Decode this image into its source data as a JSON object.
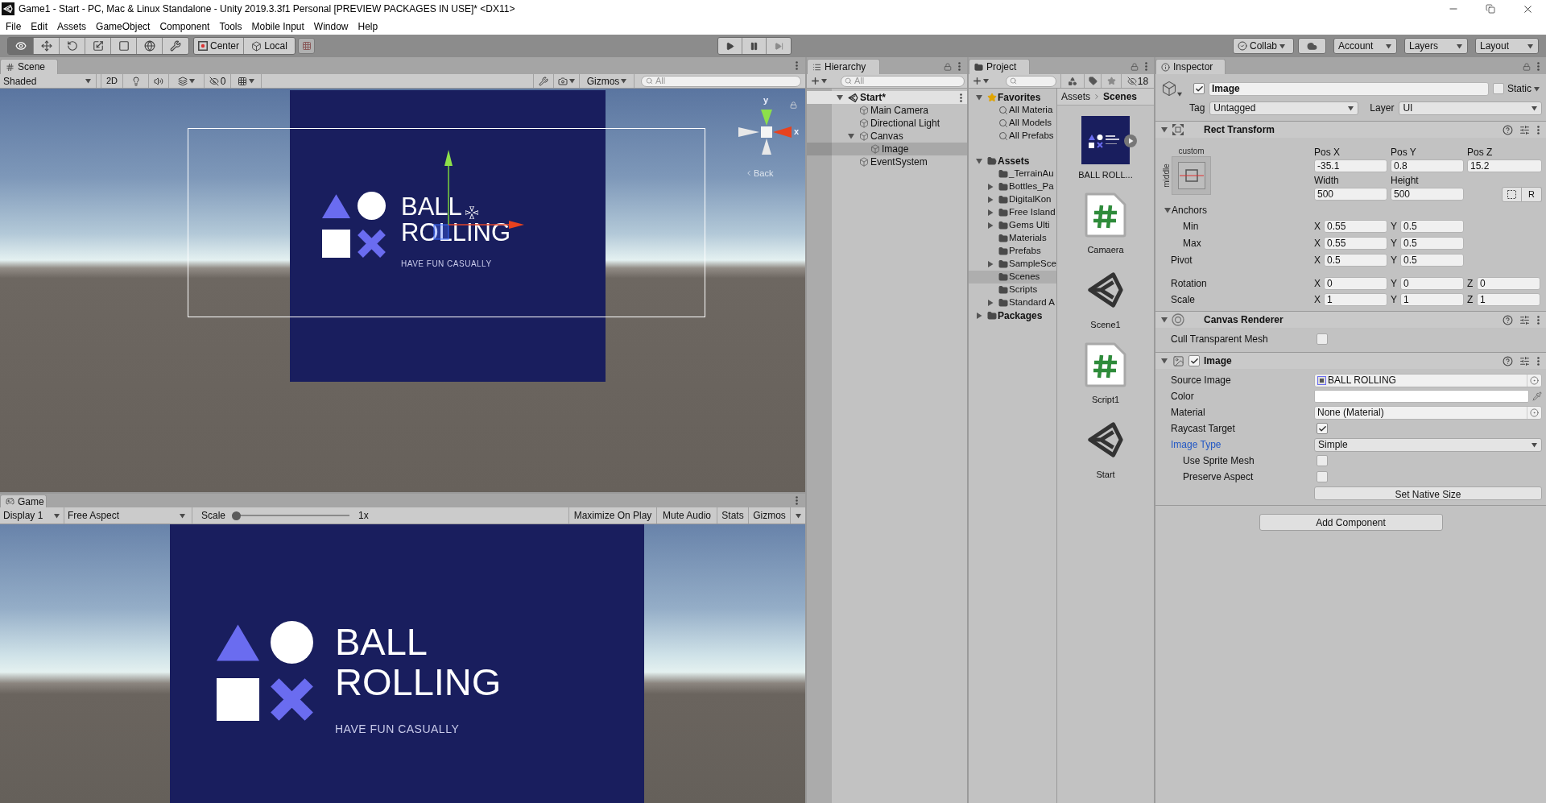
{
  "window": {
    "title": "Game1 - Start - PC, Mac & Linux Standalone - Unity 2019.3.3f1 Personal [PREVIEW PACKAGES IN USE]* <DX11>"
  },
  "menu": [
    "File",
    "Edit",
    "Assets",
    "GameObject",
    "Component",
    "Tools",
    "Mobile Input",
    "Window",
    "Help"
  ],
  "toolbar": {
    "tools": [
      {
        "kind": "view",
        "selected": true
      },
      {
        "kind": "move",
        "selected": false
      },
      {
        "kind": "rotate",
        "selected": false
      },
      {
        "kind": "scale",
        "selected": false
      },
      {
        "kind": "rect",
        "selected": false
      },
      {
        "kind": "transform",
        "selected": false
      },
      {
        "kind": "custom",
        "selected": false
      }
    ],
    "pivot_mode": "Center",
    "pivot_rotation": "Local",
    "collab": "Collab",
    "account": "Account",
    "layers": "Layers",
    "layout": "Layout"
  },
  "scene": {
    "tab": "Scene",
    "draw_mode": "Shaded",
    "mode_2d": {
      "label": "2D",
      "selected": false
    },
    "hidden_count": "0",
    "gizmos": "Gizmos",
    "search": {
      "placeholder": "All"
    },
    "gizmo_axes": {
      "y": "y",
      "x": "x"
    },
    "view_name": "Back",
    "logo": {
      "title": [
        "BALL",
        "ROLLING"
      ],
      "tagline": "HAVE FUN CASUALLY"
    }
  },
  "game": {
    "tab": "Game",
    "display": "Display 1",
    "aspect": "Free Aspect",
    "scale": {
      "label": "Scale",
      "level": 0,
      "reading": "1x"
    },
    "toggles": [
      "Maximize On Play",
      "Mute Audio",
      "Stats"
    ],
    "gizmos": "Gizmos",
    "logo": {
      "title": [
        "BALL",
        "ROLLING"
      ],
      "tagline": "HAVE FUN CASUALLY"
    }
  },
  "hierarchy": {
    "tab": "Hierarchy",
    "search": {
      "placeholder": "All"
    },
    "scene": {
      "label": "Start*",
      "selected": false,
      "expanded": true,
      "children": [
        {
          "label": "Main Camera",
          "selected": false
        },
        {
          "label": "Directional Light",
          "selected": false
        },
        {
          "label": "Canvas",
          "selected": false,
          "expanded": true,
          "children": [
            {
              "label": "Image",
              "selected": true
            }
          ]
        },
        {
          "label": "EventSystem",
          "selected": false
        }
      ]
    }
  },
  "project": {
    "tab": "Project",
    "hidden_count": "18",
    "favorites": {
      "label": "Favorites",
      "selected": false,
      "expanded": true,
      "children": [
        {
          "label": "All Materia",
          "selected": false
        },
        {
          "label": "All Models",
          "selected": false
        },
        {
          "label": "All Prefabs",
          "selected": false
        }
      ]
    },
    "assets": {
      "label": "Assets",
      "selected": false,
      "expanded": true,
      "children": [
        {
          "label": "_TerrainAu",
          "expandable": false,
          "selected": false
        },
        {
          "label": "Bottles_Pa",
          "expandable": true,
          "selected": false
        },
        {
          "label": "DigitalKon",
          "expandable": true,
          "selected": false
        },
        {
          "label": "Free Island",
          "expandable": true,
          "selected": false
        },
        {
          "label": "Gems Ulti",
          "expandable": true,
          "selected": false
        },
        {
          "label": "Materials",
          "expandable": false,
          "selected": false
        },
        {
          "label": "Prefabs",
          "expandable": false,
          "selected": false
        },
        {
          "label": "SampleSce",
          "expandable": true,
          "selected": false
        },
        {
          "label": "Scenes",
          "expandable": false,
          "selected": true
        },
        {
          "label": "Scripts",
          "expandable": false,
          "selected": false
        },
        {
          "label": "Standard A",
          "expandable": true,
          "selected": false
        }
      ]
    },
    "packages": {
      "label": "Packages",
      "selected": false,
      "expanded": false
    },
    "breadcrumb": [
      "Assets",
      "Scenes"
    ],
    "items": [
      {
        "kind": "sprite",
        "label": "BALL ROLL...",
        "selected": false
      },
      {
        "kind": "script",
        "label": "Camaera",
        "selected": false
      },
      {
        "kind": "scene",
        "label": "Scene1",
        "selected": false
      },
      {
        "kind": "script",
        "label": "Script1",
        "selected": false
      },
      {
        "kind": "scene",
        "label": "Start",
        "selected": false
      }
    ]
  },
  "inspector": {
    "tab": "Inspector",
    "object": {
      "active": true,
      "name": "Image",
      "static": {
        "label": "Static",
        "checked": false
      },
      "tag": {
        "label": "Tag",
        "value": "Untagged"
      },
      "layer": {
        "label": "Layer",
        "value": "UI"
      }
    },
    "components": [
      {
        "kind": "rect_transform",
        "title": "Rect Transform",
        "expanded": true,
        "anchor_preset": {
          "horizontal": "custom",
          "vertical": "middle"
        },
        "position": [
          {
            "label": "Pos X",
            "value": "-35.1"
          },
          {
            "label": "Pos Y",
            "value": "0.8"
          },
          {
            "label": "Pos Z",
            "value": "15.2"
          }
        ],
        "size": [
          {
            "label": "Width",
            "value": "500"
          },
          {
            "label": "Height",
            "value": "500"
          }
        ],
        "raw_button": "R",
        "anchors": {
          "label": "Anchors",
          "expanded": true,
          "rows": [
            {
              "label": "Min",
              "fields": [
                {
                  "axis": "X",
                  "value": "0.55"
                },
                {
                  "axis": "Y",
                  "value": "0.5"
                }
              ]
            },
            {
              "label": "Max",
              "fields": [
                {
                  "axis": "X",
                  "value": "0.55"
                },
                {
                  "axis": "Y",
                  "value": "0.5"
                }
              ]
            }
          ]
        },
        "rows": [
          {
            "label": "Pivot",
            "fields": [
              {
                "axis": "X",
                "value": "0.5"
              },
              {
                "axis": "Y",
                "value": "0.5"
              }
            ]
          },
          {
            "label": "Rotation",
            "fields": [
              {
                "axis": "X",
                "value": "0"
              },
              {
                "axis": "Y",
                "value": "0"
              },
              {
                "axis": "Z",
                "value": "0"
              }
            ]
          },
          {
            "label": "Scale",
            "fields": [
              {
                "axis": "X",
                "value": "1"
              },
              {
                "axis": "Y",
                "value": "1"
              },
              {
                "axis": "Z",
                "value": "1"
              }
            ]
          }
        ]
      },
      {
        "kind": "canvas_renderer",
        "title": "Canvas Renderer",
        "expanded": true,
        "properties": [
          {
            "kind": "checkbox",
            "label": "Cull Transparent Mesh",
            "checked": false,
            "highlighted": false
          }
        ]
      },
      {
        "kind": "image",
        "title": "Image",
        "expanded": true,
        "enabled": true,
        "properties": [
          {
            "kind": "sprite",
            "label": "Source Image",
            "value": "BALL ROLLING",
            "highlighted": false
          },
          {
            "kind": "color",
            "label": "Color",
            "color": "#ffffff",
            "highlighted": false
          },
          {
            "kind": "object",
            "label": "Material",
            "value": "None (Material)",
            "highlighted": false
          },
          {
            "kind": "checkbox",
            "label": "Raycast Target",
            "checked": true,
            "highlighted": false
          },
          {
            "kind": "dropdown",
            "label": "Image Type",
            "value": "Simple",
            "highlighted": true,
            "children": [
              {
                "kind": "checkbox",
                "label": "Use Sprite Mesh",
                "checked": false,
                "highlighted": false
              },
              {
                "kind": "checkbox",
                "label": "Preserve Aspect",
                "checked": false,
                "highlighted": false
              },
              {
                "kind": "button",
                "label": "Set Native Size"
              }
            ]
          }
        ]
      }
    ],
    "add_component": "Add Component"
  }
}
